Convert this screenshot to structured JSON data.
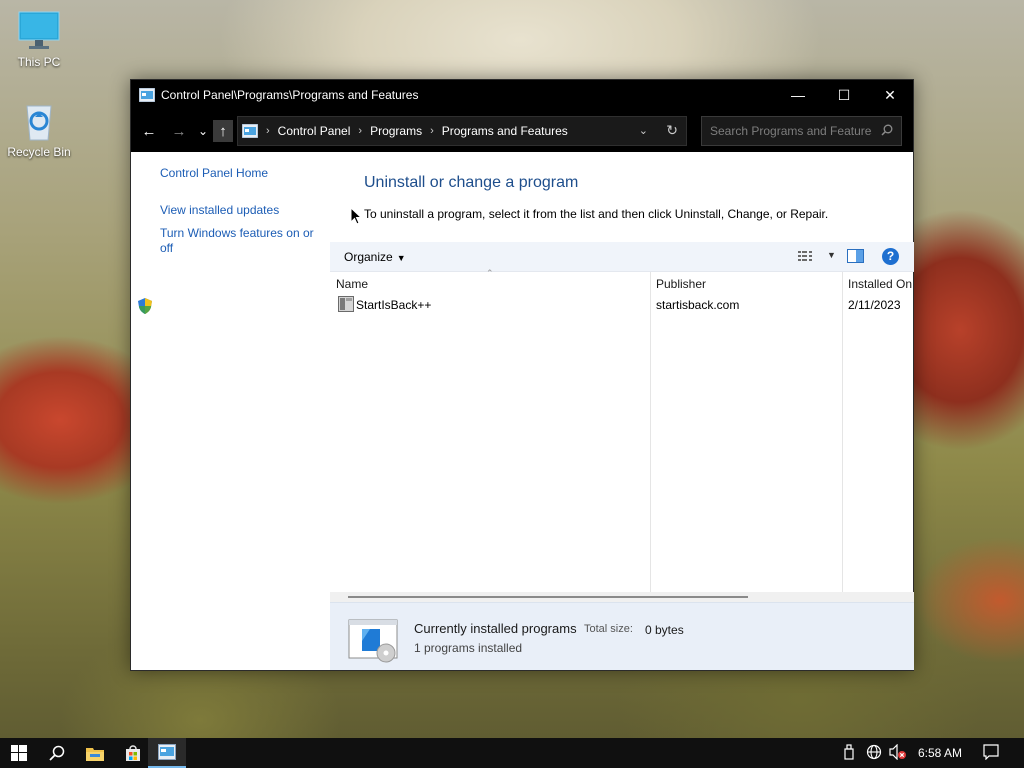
{
  "desktop": {
    "icons": [
      {
        "label": "This PC",
        "icon": "monitor-icon"
      },
      {
        "label": "Recycle Bin",
        "icon": "recycle-bin-icon"
      }
    ]
  },
  "window": {
    "title": "Control Panel\\Programs\\Programs and Features",
    "controls": {
      "minimize": "—",
      "maximize": "☐",
      "close": "✕"
    }
  },
  "navigation": {
    "back": "←",
    "forward": "→",
    "recent": "⌄",
    "up": "↑",
    "breadcrumbs": [
      "Control Panel",
      "Programs",
      "Programs and Features"
    ],
    "separator": "›",
    "search_placeholder": "Search Programs and Features"
  },
  "left_pane": {
    "links": [
      "Control Panel Home",
      "View installed updates",
      "Turn Windows features on or off"
    ]
  },
  "main": {
    "heading": "Uninstall or change a program",
    "description": "To uninstall a program, select it from the list and then click Uninstall, Change, or Repair.",
    "organize_label": "Organize",
    "help_label": "?",
    "columns": [
      "Name",
      "Publisher",
      "Installed On"
    ],
    "programs": [
      {
        "name": "StartIsBack++",
        "publisher": "startisback.com",
        "installed_on": "2/11/2023"
      }
    ]
  },
  "details": {
    "title": "Currently installed programs",
    "size_label": "Total size:",
    "size_value": "0 bytes",
    "count": "1 programs installed"
  },
  "taskbar": {
    "time": "6:58 AM",
    "items": [
      "start-icon",
      "search-icon",
      "file-explorer-icon",
      "store-icon",
      "control-panel-icon"
    ],
    "tray": [
      "usb-icon",
      "network-icon",
      "volume-muted-icon",
      "notification-icon"
    ]
  },
  "colors": {
    "accent": "#1e6fd0",
    "link": "#1c5db5",
    "heading": "#1e4e8c",
    "titlebar": "#000000"
  }
}
